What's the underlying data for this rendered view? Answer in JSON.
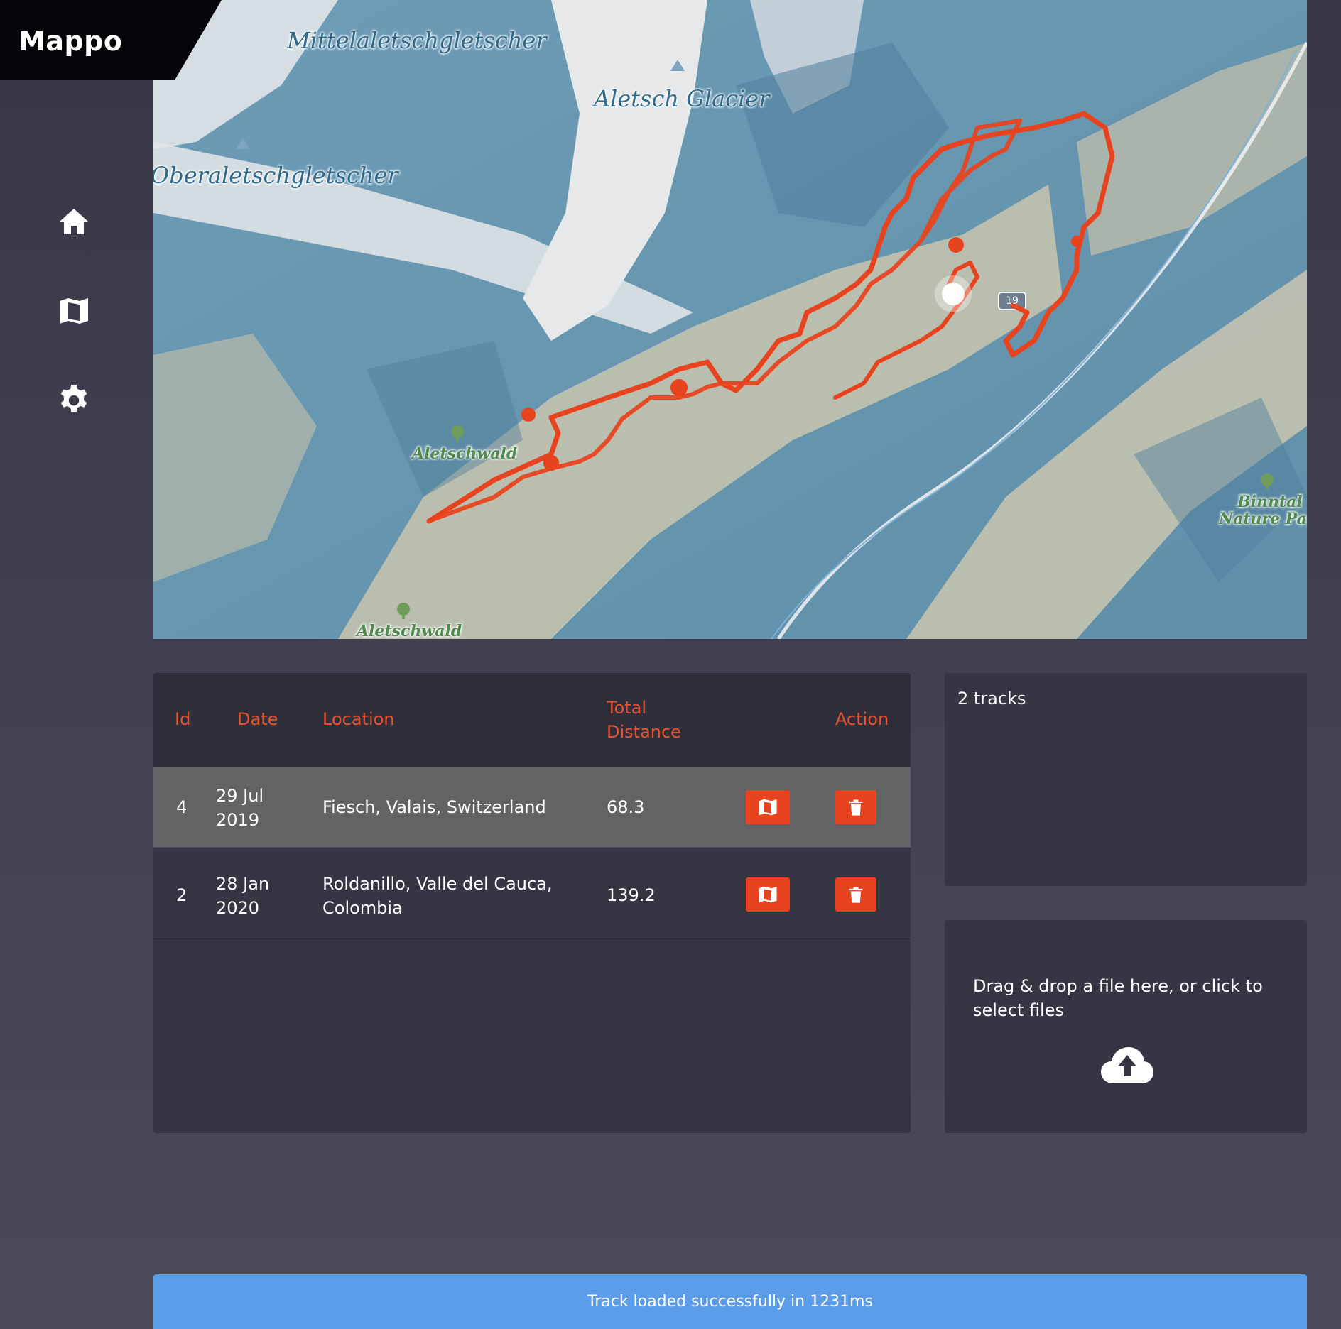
{
  "app": {
    "title": "Mappo"
  },
  "nav": {
    "items": [
      {
        "icon": "home-icon"
      },
      {
        "icon": "map-icon"
      },
      {
        "icon": "gear-icon"
      }
    ]
  },
  "map": {
    "labels": {
      "mittelaletsch": "Mittelaletschgletscher",
      "aletsch_glacier": "Aletsch Glacier",
      "oberaletsch": "Oberaletschgletscher",
      "aletschwald_1": "Aletschwald",
      "aletschwald_2": "Aletschwald",
      "binntal_1": "Binntal",
      "binntal_2": "Nature Park",
      "road_shield": "19"
    },
    "track_color": "#e8431f"
  },
  "table": {
    "headers": {
      "id": "Id",
      "date": "Date",
      "location": "Location",
      "distance_1": "Total",
      "distance_2": "Distance",
      "action": "Action"
    },
    "rows": [
      {
        "id": "4",
        "date_1": "29 Jul",
        "date_2": "2019",
        "location_1": "Fiesch, Valais, Switzerland",
        "location_2": "",
        "distance": "68.3"
      },
      {
        "id": "2",
        "date_1": "28 Jan",
        "date_2": "2020",
        "location_1": "Roldanillo, Valle del Cauca,",
        "location_2": "Colombia",
        "distance": "139.2"
      }
    ]
  },
  "summary": {
    "tracks_count": "2 tracks"
  },
  "upload": {
    "prompt": "Drag & drop a file here, or click to select files",
    "icon": "cloud-upload-icon"
  },
  "toast": {
    "message": "Track loaded successfully in 1231ms"
  },
  "colors": {
    "accent": "#e8431f",
    "header_text": "#e8522e",
    "toast": "#5b9de8",
    "panel": "#363544"
  }
}
